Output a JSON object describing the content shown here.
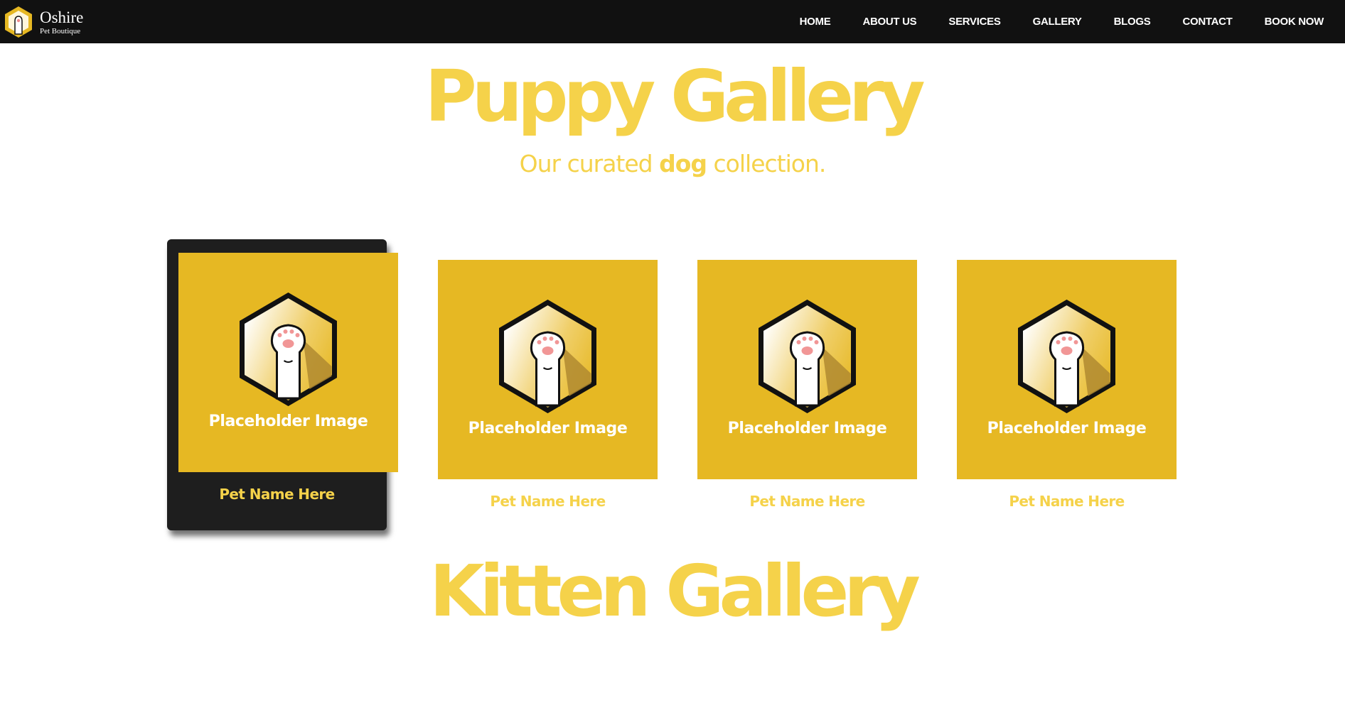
{
  "brand": {
    "name": "Oshire",
    "tagline": "Pet Boutique",
    "colors": {
      "navbar": "#111111",
      "accent": "#f5d24a",
      "tile": "#e6b823",
      "active_card": "#1e1e1e"
    }
  },
  "nav": {
    "items": [
      {
        "label": "HOME"
      },
      {
        "label": "ABOUT US"
      },
      {
        "label": "SERVICES"
      },
      {
        "label": "GALLERY"
      },
      {
        "label": "BLOGS"
      },
      {
        "label": "CONTACT"
      },
      {
        "label": "BOOK NOW"
      }
    ]
  },
  "puppy_gallery": {
    "title": "Puppy Gallery",
    "subtitle_before": "Our curated ",
    "subtitle_emphasis": "dog",
    "subtitle_after": " collection.",
    "cards": [
      {
        "image_label": "Placeholder Image",
        "pet_name": "Pet Name Here",
        "icon": "paw-hexagon-icon",
        "state": "hovered"
      },
      {
        "image_label": "Placeholder Image",
        "pet_name": "Pet Name Here",
        "icon": "paw-hexagon-icon"
      },
      {
        "image_label": "Placeholder Image",
        "pet_name": "Pet Name Here",
        "icon": "paw-hexagon-icon"
      },
      {
        "image_label": "Placeholder Image",
        "pet_name": "Pet Name Here",
        "icon": "paw-hexagon-icon"
      }
    ]
  },
  "kitten_gallery": {
    "title": "Kitten Gallery"
  }
}
